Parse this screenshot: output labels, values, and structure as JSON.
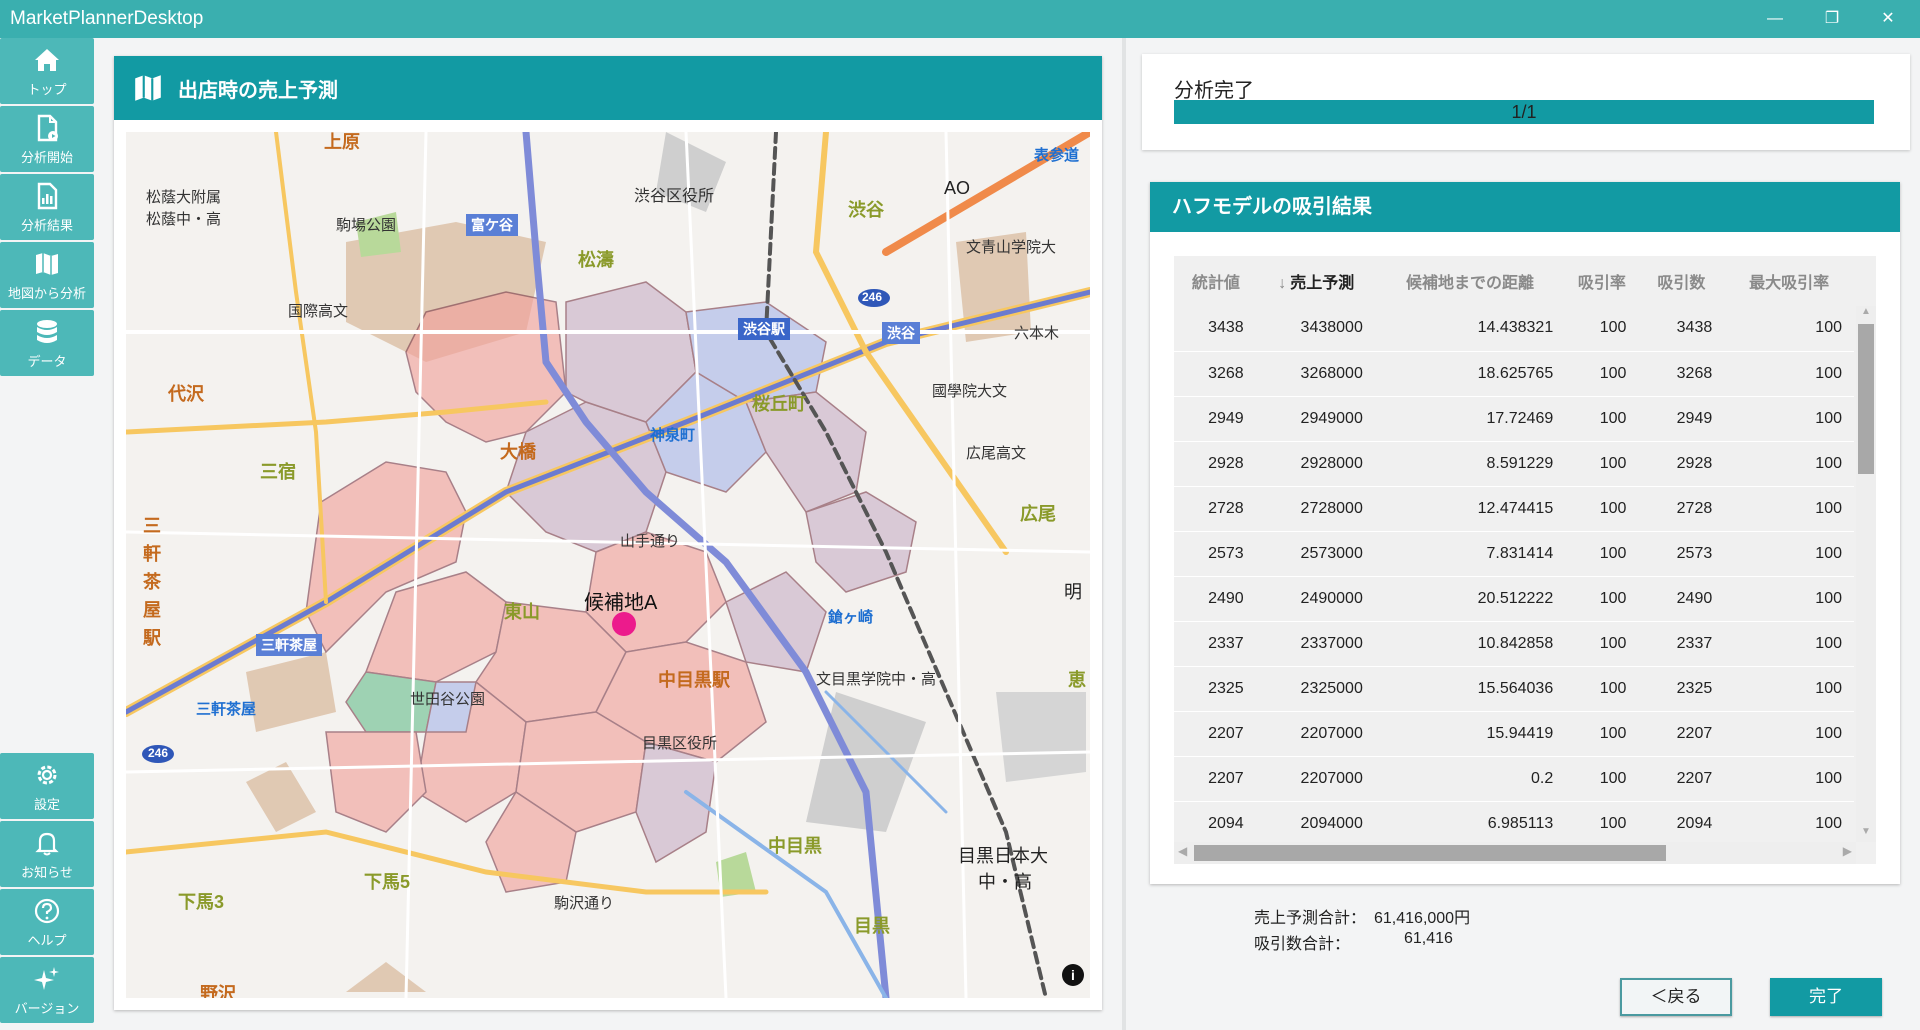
{
  "window": {
    "title": "MarketPlannerDesktop",
    "minimize": "—",
    "restore": "❐",
    "close": "✕"
  },
  "sidebar": {
    "top_items": [
      {
        "label": "トップ",
        "icon": "home-icon"
      },
      {
        "label": "分析開始",
        "icon": "file-play-icon"
      },
      {
        "label": "分析結果",
        "icon": "chart-file-icon"
      },
      {
        "label": "地図から分析",
        "icon": "map-icon"
      },
      {
        "label": "データ",
        "icon": "database-icon"
      }
    ],
    "bottom_items": [
      {
        "label": "設定",
        "icon": "gear-icon"
      },
      {
        "label": "お知らせ",
        "icon": "bell-icon"
      },
      {
        "label": "ヘルプ",
        "icon": "help-icon"
      },
      {
        "label": "バージョン",
        "icon": "sparkle-icon"
      }
    ]
  },
  "map_panel": {
    "title": "出店時の売上予測",
    "candidate_label": "候補地A",
    "labels": {
      "uehara": "上原",
      "shotoku": "松蔭大附属",
      "shotoku_mid": "松蔭中・高",
      "komaba_park": "駒場公園",
      "tomigaya": "富ケ谷",
      "matsutou": "松濤",
      "shibuya_ward": "渋谷区役所",
      "shibuya": "渋谷",
      "ao": "AO",
      "omotesando": "表参道",
      "aoyama_univ": "文青山学院大",
      "kokusai": "国際高文",
      "shibuya_station": "渋谷駅",
      "route_246a": "246",
      "shibuya_ic": "渋谷",
      "rokuhongi": "六本木",
      "daizawa": "代沢",
      "ohashi": "大橋",
      "shinsen": "神泉町",
      "sakuragaoka": "桜丘町",
      "kokugakuin": "國學院大文",
      "hiroo_high": "広尾高文",
      "sanshuku": "三宿",
      "sangenjaya_v": "三軒茶屋駅",
      "hiroo": "広尾",
      "higashiyama": "東山",
      "sangenjaya_s1": "三軒茶屋",
      "sangenjaya_s2": "三軒茶屋",
      "route_246b": "246",
      "setagaya_park": "世田谷公園",
      "nakameguro_st": "中目黒駅",
      "meguro_gakuin": "文目黒学院中・高",
      "ebisu": "恵",
      "meguro_ward": "目黒区役所",
      "nakameguro": "中目黒",
      "meguro_univ": "目黒日本大",
      "meguro_univ2": "中・高",
      "shimouma3": "下馬3",
      "shimouma5": "下馬5",
      "meguro": "目黒",
      "nozawa": "野沢",
      "yamanote": "山手通り",
      "hill": "明",
      "komazawa": "駒沢通り",
      "tsuji": "鎗ヶ崎"
    },
    "info": "i"
  },
  "progress": {
    "label": "分析完了",
    "text": "1/1",
    "fraction": 1.0
  },
  "huff": {
    "title": "ハフモデルの吸引結果",
    "columns": [
      "統計値",
      "売上予測",
      "候補地までの距離",
      "吸引率",
      "吸引数",
      "最大吸引率"
    ],
    "sort_arrow": "↓",
    "rows": [
      [
        "3438",
        "3438000",
        "14.438321",
        "100",
        "3438",
        "100"
      ],
      [
        "3268",
        "3268000",
        "18.625765",
        "100",
        "3268",
        "100"
      ],
      [
        "2949",
        "2949000",
        "17.72469",
        "100",
        "2949",
        "100"
      ],
      [
        "2928",
        "2928000",
        "8.591229",
        "100",
        "2928",
        "100"
      ],
      [
        "2728",
        "2728000",
        "12.474415",
        "100",
        "2728",
        "100"
      ],
      [
        "2573",
        "2573000",
        "7.831414",
        "100",
        "2573",
        "100"
      ],
      [
        "2490",
        "2490000",
        "20.512222",
        "100",
        "2490",
        "100"
      ],
      [
        "2337",
        "2337000",
        "10.842858",
        "100",
        "2337",
        "100"
      ],
      [
        "2325",
        "2325000",
        "15.564036",
        "100",
        "2325",
        "100"
      ],
      [
        "2207",
        "2207000",
        "15.94419",
        "100",
        "2207",
        "100"
      ],
      [
        "2207",
        "2207000",
        "0.2",
        "100",
        "2207",
        "100"
      ],
      [
        "2094",
        "2094000",
        "6.985113",
        "100",
        "2094",
        "100"
      ]
    ]
  },
  "totals": {
    "sales_label": "売上予測合計：",
    "sales_value": "61,416,000円",
    "attract_label": "吸引数合計：",
    "attract_value": "61,416"
  },
  "buttons": {
    "back": "＜戻る",
    "finish": "完了"
  },
  "colors": {
    "accent": "#129aa3",
    "titlebar": "#3aafaf",
    "candidate": "#ec1b8c",
    "area_red": "#f2a09b",
    "area_purple": "#c9b0c8",
    "area_blue": "#a9b8ea"
  }
}
